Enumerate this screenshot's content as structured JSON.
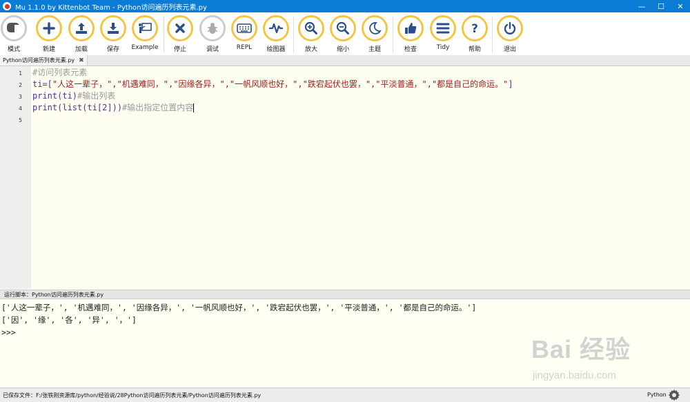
{
  "window": {
    "title": "Mu 1.1.0 by Kittenbot Team - Python访问遍历列表元素.py",
    "minimize": "—",
    "maximize": "☐",
    "close": "✕"
  },
  "toolbar": {
    "buttons": [
      {
        "label": "模式",
        "icon": "mode-icon"
      },
      {
        "label": "新建",
        "icon": "plus-icon"
      },
      {
        "label": "加载",
        "icon": "upload-icon"
      },
      {
        "label": "保存",
        "icon": "download-icon"
      },
      {
        "label": "Example",
        "icon": "presentation-icon"
      },
      {
        "label": "停止",
        "icon": "close-icon"
      },
      {
        "label": "调试",
        "icon": "bug-icon"
      },
      {
        "label": "REPL",
        "icon": "keyboard-icon"
      },
      {
        "label": "绘图器",
        "icon": "pulse-icon"
      },
      {
        "label": "放大",
        "icon": "zoom-in-icon"
      },
      {
        "label": "缩小",
        "icon": "zoom-out-icon"
      },
      {
        "label": "主题",
        "icon": "moon-icon"
      },
      {
        "label": "检查",
        "icon": "thumbs-up-icon"
      },
      {
        "label": "Tidy",
        "icon": "lines-icon"
      },
      {
        "label": "帮助",
        "icon": "question-icon"
      },
      {
        "label": "退出",
        "icon": "power-icon"
      }
    ],
    "accent": "#f4c542",
    "icon_color": "#2b4f8c"
  },
  "editor": {
    "tab_label": "Python访问遍历列表元素.py",
    "tab_close": "✖",
    "line_numbers": [
      "1",
      "2",
      "3",
      "4",
      "5"
    ],
    "lines": [
      {
        "a": "#访问列表元素",
        "b": "",
        "c": ""
      },
      {
        "a": "ti=[",
        "b": "\"人这一辈子，\",\"机遇难同，\",\"因缘各异，\",\"一帆风顺也好，\",\"跌宕起伏也罢，\",\"平淡普通，\",\"都是自己的命运。\"",
        "c": "]"
      },
      {
        "a": "print(ti)",
        "b": "#输出列表",
        "c": ""
      },
      {
        "a": "print(list(ti[2]))",
        "b": "#输出指定位置内容",
        "c": ""
      }
    ]
  },
  "runner": {
    "title": "运行脚本：Python访问遍历列表元素.py",
    "output": [
      "['人这一辈子，', '机遇难同，', '因缘各异，', '一帆风顺也好，', '跌宕起伏也罢，', '平淡普通，', '都是自己的命运。']",
      "['因', '缘', '各', '异', '，']",
      ">>>"
    ]
  },
  "watermark": {
    "main": "Bai 经验",
    "sub": "jingyan.baidu.com"
  },
  "status": {
    "path": "已保存文件：F:/张铁刚资源库/python/经验说/28Python访问遍历列表元素/Python访问遍历列表元素.py",
    "mode": "Python"
  }
}
